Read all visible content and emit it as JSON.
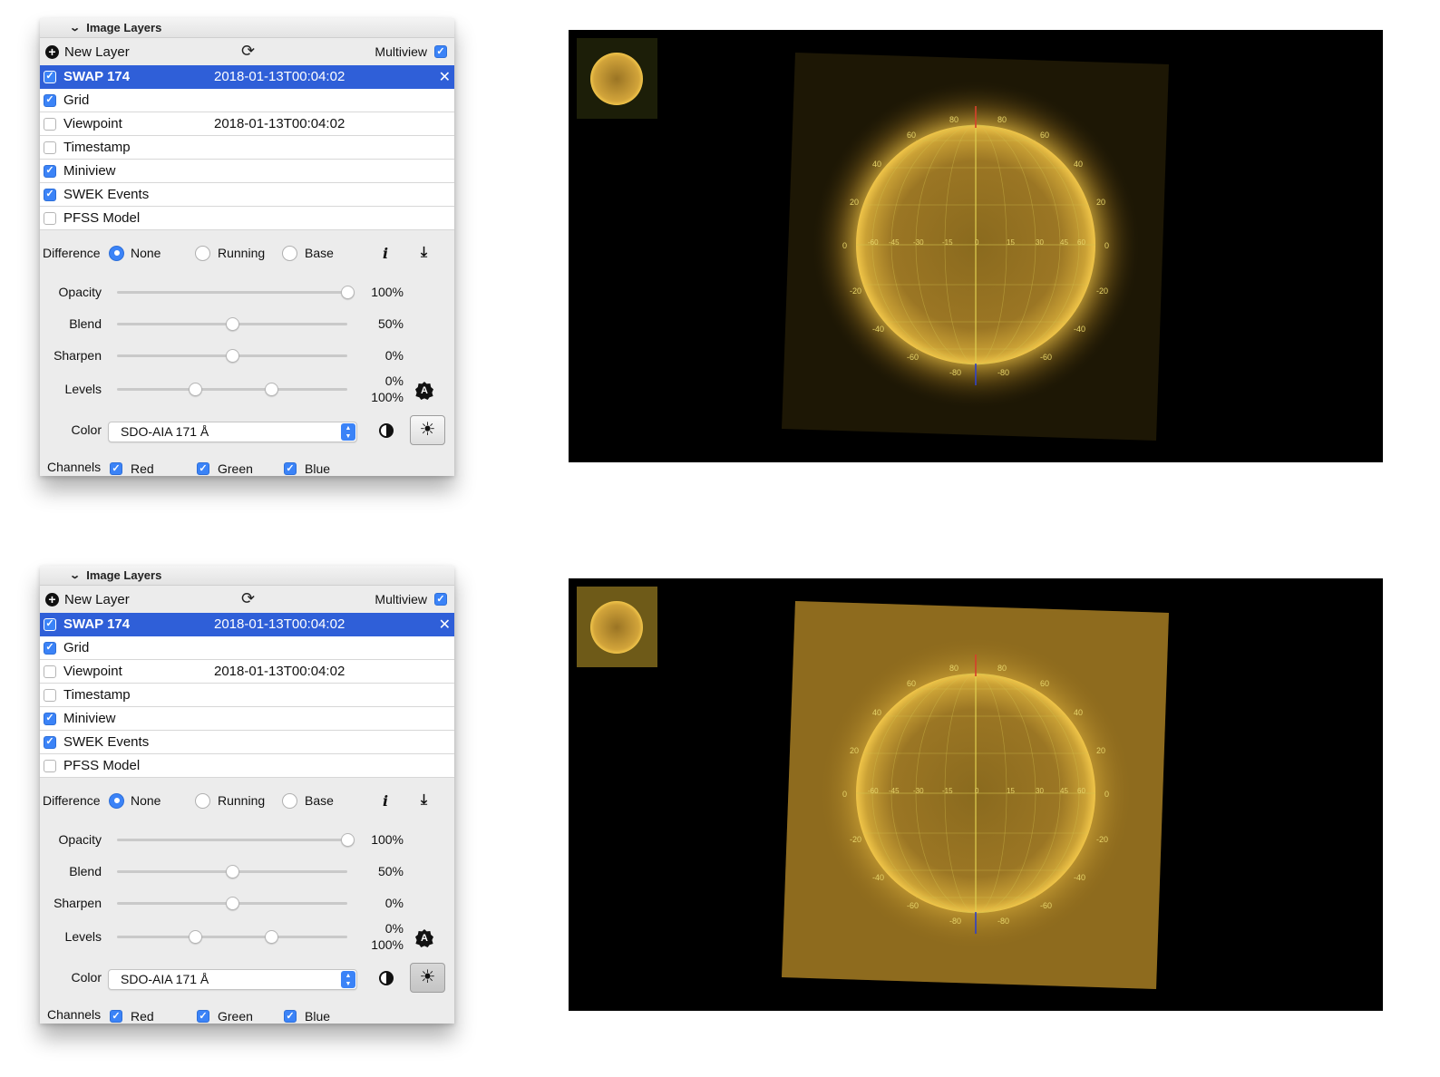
{
  "colors": {
    "selection": "#2f5fd8",
    "check": "#3b83f7",
    "sun": "#d5a12e"
  },
  "panels": [
    {
      "header": "Image Layers",
      "new_layer": "New Layer",
      "multiview": "Multiview",
      "layers": [
        {
          "name": "SWAP 174",
          "time": "2018-01-13T00:04:02",
          "checked": true,
          "selected": true
        },
        {
          "name": "Grid",
          "time": "",
          "checked": true
        },
        {
          "name": "Viewpoint",
          "time": "2018-01-13T00:04:02",
          "checked": false
        },
        {
          "name": "Timestamp",
          "time": "",
          "checked": false
        },
        {
          "name": "Miniview",
          "time": "",
          "checked": true
        },
        {
          "name": "SWEK Events",
          "time": "",
          "checked": true
        },
        {
          "name": "PFSS Model",
          "time": "",
          "checked": false
        }
      ],
      "difference": {
        "label": "Difference",
        "options": [
          "None",
          "Running",
          "Base"
        ],
        "selected": "None"
      },
      "opacity": {
        "label": "Opacity",
        "value": "100%",
        "fraction": 1.0
      },
      "blend": {
        "label": "Blend",
        "value": "50%",
        "fraction": 0.5
      },
      "sharpen": {
        "label": "Sharpen",
        "value": "0%",
        "fraction": 0.5
      },
      "levels": {
        "label": "Levels",
        "low": "0%",
        "high": "100%",
        "low_fraction": 0.34,
        "high_fraction": 0.67
      },
      "color": {
        "label": "Color",
        "selected": "SDO-AIA 171 Å"
      },
      "channels": {
        "label": "Channels",
        "red": "Red",
        "green": "Green",
        "blue": "Blue"
      }
    },
    {
      "header": "Image Layers",
      "new_layer": "New Layer",
      "multiview": "Multiview",
      "layers": [
        {
          "name": "SWAP 174",
          "time": "2018-01-13T00:04:02",
          "checked": true,
          "selected": true
        },
        {
          "name": "Grid",
          "time": "",
          "checked": true
        },
        {
          "name": "Viewpoint",
          "time": "2018-01-13T00:04:02",
          "checked": false
        },
        {
          "name": "Timestamp",
          "time": "",
          "checked": false
        },
        {
          "name": "Miniview",
          "time": "",
          "checked": true
        },
        {
          "name": "SWEK Events",
          "time": "",
          "checked": true
        },
        {
          "name": "PFSS Model",
          "time": "",
          "checked": false
        }
      ],
      "difference": {
        "label": "Difference",
        "options": [
          "None",
          "Running",
          "Base"
        ],
        "selected": "None"
      },
      "opacity": {
        "label": "Opacity",
        "value": "100%",
        "fraction": 1.0
      },
      "blend": {
        "label": "Blend",
        "value": "50%",
        "fraction": 0.5
      },
      "sharpen": {
        "label": "Sharpen",
        "value": "0%",
        "fraction": 0.5
      },
      "levels": {
        "label": "Levels",
        "low": "0%",
        "high": "100%",
        "low_fraction": 0.34,
        "high_fraction": 0.67
      },
      "color": {
        "label": "Color",
        "selected": "SDO-AIA 171 Å"
      },
      "channels": {
        "label": "Channels",
        "red": "Red",
        "green": "Green",
        "blue": "Blue"
      }
    }
  ],
  "grid_labels": {
    "lat_left": [
      "80",
      "60",
      "40",
      "20",
      "0",
      "-20",
      "-40",
      "-60",
      "-80"
    ],
    "lat_right": [
      "80",
      "60",
      "40",
      "20",
      "0",
      "-20",
      "-40",
      "-60",
      "-80"
    ],
    "lon": [
      "-60",
      "-45",
      "-30",
      "-15",
      "0",
      "15",
      "30",
      "45",
      "60"
    ]
  }
}
